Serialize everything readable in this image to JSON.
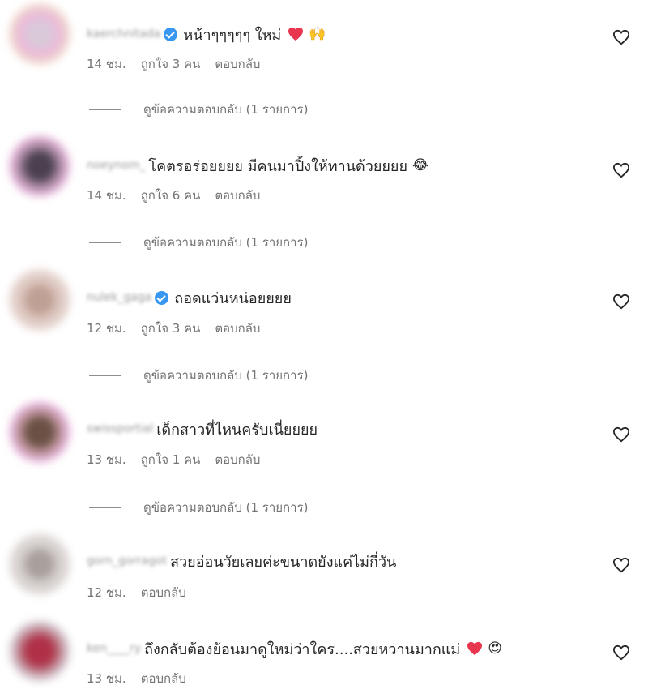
{
  "comments": [
    {
      "username": "kaerchnitada",
      "verified": true,
      "text": "หน้าๆๆๆๆๆ ใหม่",
      "emoji": "🙌",
      "has_pink_heart": true,
      "time": "14 ชม.",
      "likes": "ถูกใจ 3 คน",
      "reply": "ตอบกลับ",
      "view_replies": "ดูข้อความตอบกลับ (1 รายการ)"
    },
    {
      "username": "noeynom_",
      "verified": false,
      "text": "โคตรอร่อยยยย มีคนมาปิ้งให้ทานด้วยยยย",
      "emoji": "😂",
      "has_pink_heart": false,
      "time": "14 ชม.",
      "likes": "ถูกใจ 6 คน",
      "reply": "ตอบกลับ",
      "view_replies": "ดูข้อความตอบกลับ (1 รายการ)"
    },
    {
      "username": "nulek_gaga",
      "verified": true,
      "text": "ถอดแว่นหน่อยยยย",
      "emoji": "",
      "has_pink_heart": false,
      "time": "12 ชม.",
      "likes": "ถูกใจ 3 คน",
      "reply": "ตอบกลับ",
      "view_replies": "ดูข้อความตอบกลับ (1 รายการ)"
    },
    {
      "username": "swissportial",
      "verified": false,
      "text": "เด็กสาวที่ไหนครับเนี่ยยยย",
      "emoji": "",
      "has_pink_heart": false,
      "time": "13 ชม.",
      "likes": "ถูกใจ 1 คน",
      "reply": "ตอบกลับ",
      "view_replies": "ดูข้อความตอบกลับ (1 รายการ)"
    },
    {
      "username": "gorn_gorragot",
      "verified": false,
      "text": "สวยอ่อนวัยเลยค่ะขนาดยังแค่ไม่กี่วัน",
      "emoji": "",
      "has_pink_heart": false,
      "time": "12 ชม.",
      "likes": "",
      "reply": "ตอบกลับ",
      "view_replies": ""
    },
    {
      "username": "ken____ry",
      "verified": false,
      "text": "ถึงกลับต้องย้อนมาดูใหม่ว่าใคร....สวยหวานมากแม่",
      "emoji": "😍",
      "has_pink_heart": true,
      "time": "13 ชม.",
      "likes": "",
      "reply": "ตอบกลับ",
      "view_replies": ""
    }
  ],
  "icons": {
    "like": "heart-outline-icon",
    "verified": "verified-badge-icon",
    "heart_emoji": "pink-heart-emoji"
  },
  "colors": {
    "text": "#262626",
    "meta": "#737373",
    "verified": "#3897f0",
    "heart_emoji": "#e8364f"
  }
}
